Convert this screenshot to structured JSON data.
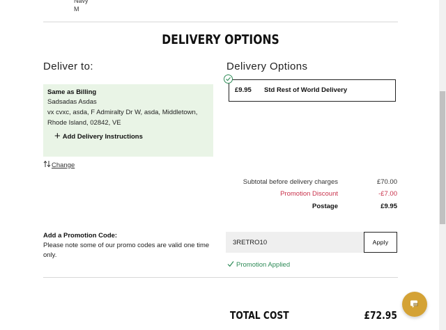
{
  "item": {
    "color": "Navy",
    "size": "M"
  },
  "heading": "DELIVERY OPTIONS",
  "deliver_to": {
    "title": "Deliver to:",
    "address_title": "Same as Billing",
    "name": "Sadsadas Asdas",
    "line1": "vx cvxc, asda, F Admiralty Dr W, asda, Middletown,",
    "line2": "Rhode Island, 02842, VE",
    "add_instructions": "Add Delivery Instructions",
    "change": "Change"
  },
  "delivery_options": {
    "title": "Delivery Options",
    "option": {
      "price": "£9.95",
      "name": "Std Rest of World Delivery",
      "selected": true
    }
  },
  "summary": {
    "subtotal_label": "Subtotal before delivery charges",
    "subtotal_value": "£70.00",
    "discount_label": "Promotion Discount",
    "discount_value": "-£7.00",
    "postage_label": "Postage",
    "postage_value": "£9.95"
  },
  "promo": {
    "title": "Add a Promotion Code:",
    "note": "Please note some of our promo codes are valid one time only.",
    "code": "3RETRO10",
    "apply_label": "Apply",
    "applied_text": "Promotion Applied"
  },
  "total": {
    "label": "TOTAL COST",
    "value": "£72.95"
  },
  "colors": {
    "accent_green": "#2e8b57",
    "discount_red": "#c8304a",
    "billing_bg": "#e9f4e6",
    "chat_gold": "#d4a235"
  },
  "icons": [
    "check-circle-icon",
    "plus-icon",
    "swap-arrows-icon",
    "checkmark-icon",
    "chat-icon"
  ]
}
